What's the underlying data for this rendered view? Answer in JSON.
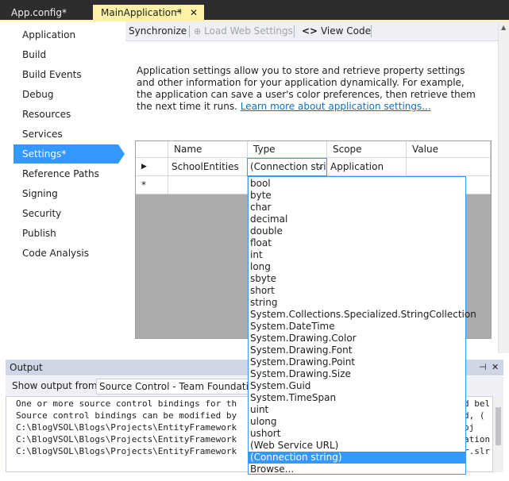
{
  "tabs": {
    "inactive_label": "App.config*",
    "active_label": "MainApplication*",
    "pin_glyph": "⊣",
    "close_glyph": "✕"
  },
  "nav": {
    "items": [
      "Application",
      "Build",
      "Build Events",
      "Debug",
      "Resources",
      "Services",
      "Settings*",
      "Reference Paths",
      "Signing",
      "Security",
      "Publish",
      "Code Analysis"
    ],
    "selected_index": 6
  },
  "toolbar": {
    "synchronize": "Synchronize",
    "load_web_settings": "Load Web Settings",
    "view_code": "View Code"
  },
  "description": {
    "text": "Application settings allow you to store and retrieve property settings and other information for your application dynamically. For example, the application can save a user's color preferences, then retrieve them the next time it runs. ",
    "link": "Learn more about application settings..."
  },
  "grid": {
    "columns": [
      "Name",
      "Type",
      "Scope",
      "Value"
    ],
    "row": {
      "name": "SchoolEntities",
      "type": "(Connection string)",
      "scope": "Application",
      "value": ""
    },
    "current_row_glyph": "▶",
    "new_row_glyph": "*"
  },
  "dropdown": {
    "items": [
      "bool",
      "byte",
      "char",
      "decimal",
      "double",
      "float",
      "int",
      "long",
      "sbyte",
      "short",
      "string",
      "System.Collections.Specialized.StringCollection",
      "System.DateTime",
      "System.Drawing.Color",
      "System.Drawing.Font",
      "System.Drawing.Point",
      "System.Drawing.Size",
      "System.Guid",
      "System.TimeSpan",
      "uint",
      "ulong",
      "ushort",
      "(Web Service URL)",
      "(Connection string)",
      "Browse..."
    ],
    "selected_index": 23
  },
  "output": {
    "title": "Output",
    "show_from_label": "Show output from:",
    "source": "Source Control - Team Foundation",
    "lines": [
      "One or more source control bindings for th",
      "Source control bindings can be modified by",
      "C:\\BlogVSOL\\Blogs\\Projects\\EntityFramework",
      "C:\\BlogVSOL\\Blogs\\Projects\\EntityFramework",
      "C:\\BlogVSOL\\Blogs\\Projects\\EntityFramework"
    ],
    "right_fragments": [
      "d bel",
      "d, (",
      "oj",
      "ation",
      "r.slr"
    ]
  },
  "colors": {
    "accent": "#3399ff",
    "active_tab": "#fff1a6",
    "chrome": "#2d2d30",
    "output_title": "#cfd6e5"
  }
}
